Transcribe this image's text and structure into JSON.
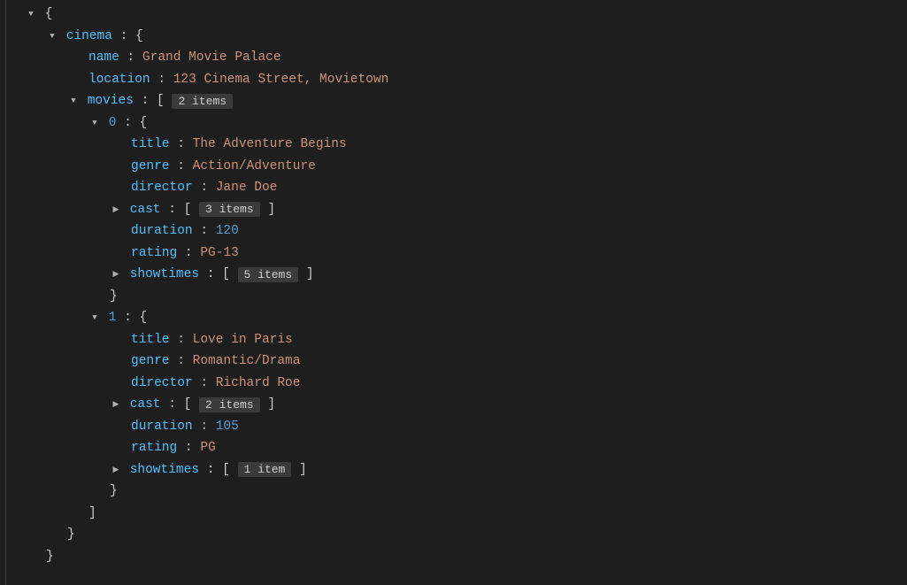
{
  "tree": {
    "cinema": {
      "key": "cinema",
      "name_key": "name",
      "name_val": "Grand Movie Palace",
      "location_key": "location",
      "location_val": "123 Cinema Street, Movietown",
      "movies_key": "movies",
      "movies_badge": "2 items",
      "movies": [
        {
          "index": "0",
          "title_key": "title",
          "title_val": "The Adventure Begins",
          "genre_key": "genre",
          "genre_val": "Action/Adventure",
          "director_key": "director",
          "director_val": "Jane Doe",
          "cast_key": "cast",
          "cast_badge": "3 items",
          "duration_key": "duration",
          "duration_val": "120",
          "rating_key": "rating",
          "rating_val": "PG-13",
          "showtimes_key": "showtimes",
          "showtimes_badge": "5 items"
        },
        {
          "index": "1",
          "title_key": "title",
          "title_val": "Love in Paris",
          "genre_key": "genre",
          "genre_val": "Romantic/Drama",
          "director_key": "director",
          "director_val": "Richard Roe",
          "cast_key": "cast",
          "cast_badge": "2 items",
          "duration_key": "duration",
          "duration_val": "105",
          "rating_key": "rating",
          "rating_val": "PG",
          "showtimes_key": "showtimes",
          "showtimes_badge": "1 item"
        }
      ]
    }
  }
}
